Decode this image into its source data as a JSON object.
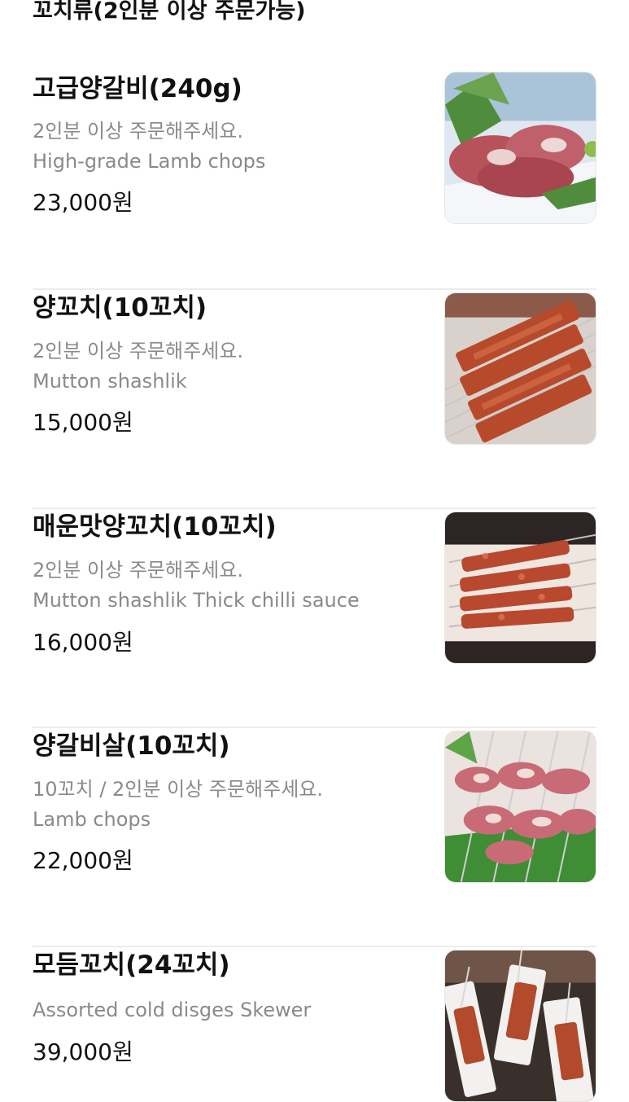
{
  "section": {
    "title": "꼬치류(2인분 이상 주문가능)"
  },
  "items": [
    {
      "name": "고급양갈비(240g)",
      "note": "2인분 이상 주문해주세요.",
      "english": "High-grade Lamb chops",
      "price": "23,000원",
      "image": "lamb-chops-photo"
    },
    {
      "name": "양꼬치(10꼬치)",
      "note": "2인분 이상 주문해주세요.",
      "english": "Mutton shashlik",
      "price": "15,000원",
      "image": "mutton-skewers-photo"
    },
    {
      "name": "매운맛양꼬치(10꼬치)",
      "note": "2인분 이상 주문해주세요.",
      "english": "Mutton shashlik Thick chilli sauce",
      "price": "16,000원",
      "image": "spicy-skewers-photo"
    },
    {
      "name": "양갈비살(10꼬치)",
      "note": "10꼬치 / 2인분 이상 주문해주세요.",
      "english": "Lamb chops",
      "price": "22,000원",
      "image": "lamb-rib-skewers-photo"
    },
    {
      "name": "모듬꼬치(24꼬치)",
      "english": "Assorted cold disges Skewer",
      "price": "39,000원",
      "image": "assorted-skewers-photo"
    }
  ]
}
